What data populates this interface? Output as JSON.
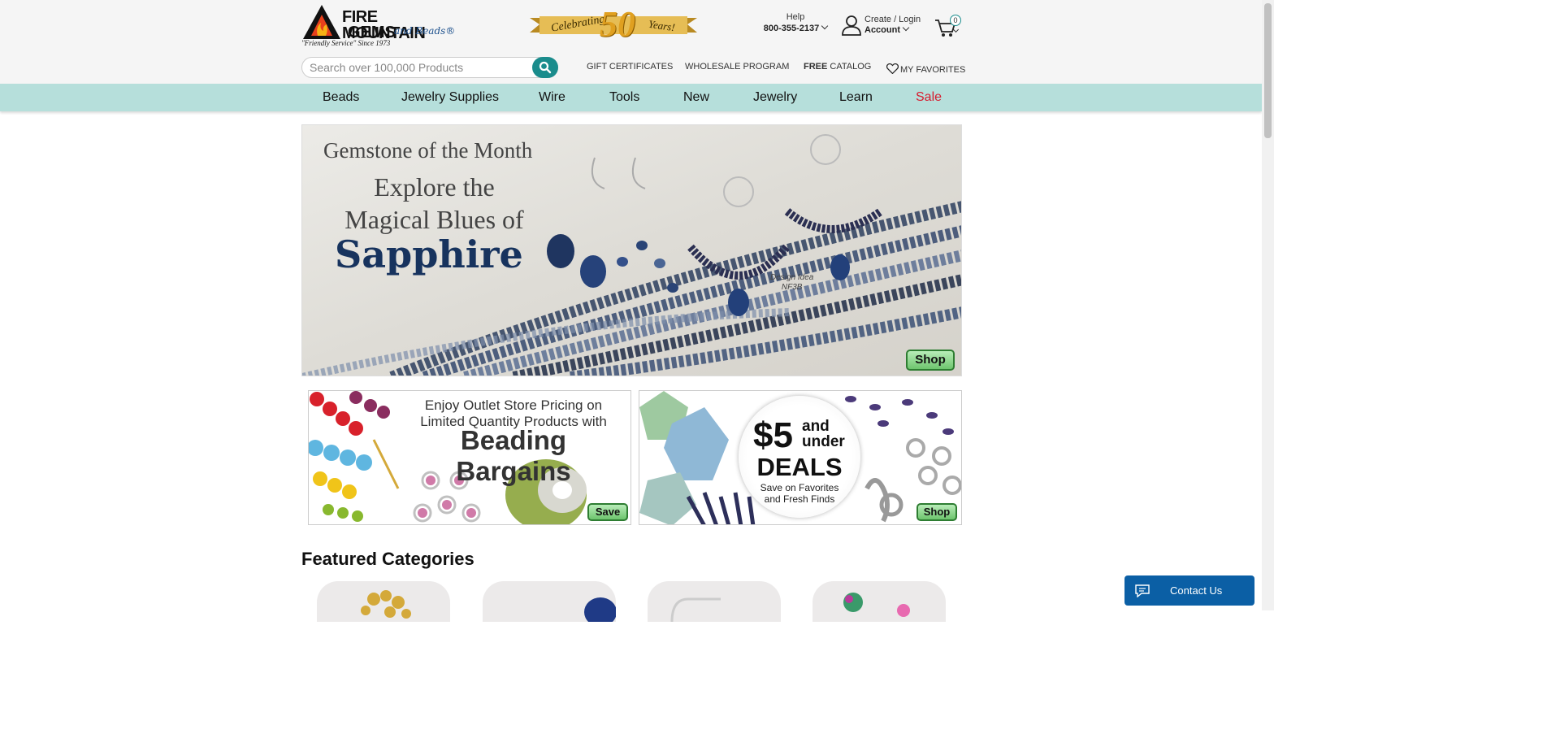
{
  "header": {
    "logo": {
      "line1": "FIRE MOUNTAIN",
      "line2": "GEMS",
      "beads": "and Beads®",
      "tagline": "\"Friendly Service\" Since 1973"
    },
    "anniversary": {
      "left": "Celebrating",
      "number": "50",
      "right": "Years!"
    },
    "help": {
      "label": "Help",
      "phone": "800-355-2137"
    },
    "account": {
      "top": "Create / Login",
      "bottom": "Account"
    },
    "cart": {
      "count": "0"
    },
    "search": {
      "placeholder": "Search over 100,000 Products"
    },
    "links": {
      "gift": "GIFT CERTIFICATES",
      "wholesale": "WHOLESALE PROGRAM",
      "catalog_bold": "FREE",
      "catalog_rest": " CATALOG",
      "favorites": "MY FAVORITES"
    }
  },
  "nav": {
    "items": [
      "Beads",
      "Jewelry Supplies",
      "Wire",
      "Tools",
      "New",
      "Jewelry",
      "Learn",
      "Sale"
    ]
  },
  "hero": {
    "line1": "Gemstone of the Month",
    "line2": "Explore the",
    "line3": "Magical Blues of",
    "line4": "Sapphire",
    "design_idea_1": "Design Idea",
    "design_idea_2": "NF3B",
    "button": "Shop"
  },
  "promo1": {
    "line1": "Enjoy Outlet Store Pricing on",
    "line2": "Limited Quantity Products with",
    "title": "Beading Bargains",
    "button": "Save"
  },
  "promo2": {
    "price": "$5",
    "and": "and",
    "under": "under",
    "deals": "DEALS",
    "sub1": "Save on Favorites",
    "sub2": "and Fresh Finds",
    "button": "Shop"
  },
  "featured": {
    "title": "Featured Categories"
  },
  "chat": {
    "label": "Contact Us"
  },
  "colors": {
    "nav_bg": "#b6dfdb",
    "accent": "#1a8c8c",
    "sale": "#d61c2f",
    "chat": "#0b5fa5"
  }
}
